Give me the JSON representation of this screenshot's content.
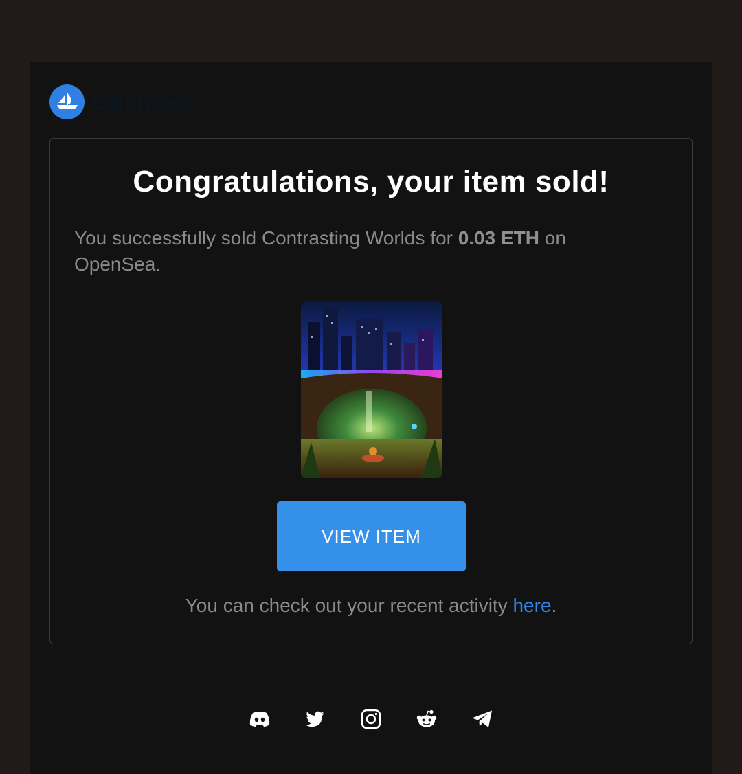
{
  "brand": {
    "name": "OpenSea",
    "logo_icon": "opensea-boat-icon",
    "logo_color": "#2f80e2"
  },
  "card": {
    "title": "Congratulations, your item sold!",
    "message_prefix": "You successfully sold Contrasting Worlds for ",
    "price": "0.03 ETH",
    "message_suffix": " on OpenSea.",
    "image_icon": "nft-artwork-contrasting-worlds",
    "button_label": "VIEW ITEM",
    "button_color": "#3490e8",
    "activity_prefix": "You can check out your recent activity ",
    "activity_link": "here",
    "activity_suffix": ".",
    "link_color": "#2f86e4"
  },
  "social": [
    {
      "name": "discord-icon"
    },
    {
      "name": "twitter-icon"
    },
    {
      "name": "instagram-icon"
    },
    {
      "name": "reddit-icon"
    },
    {
      "name": "telegram-icon"
    }
  ]
}
